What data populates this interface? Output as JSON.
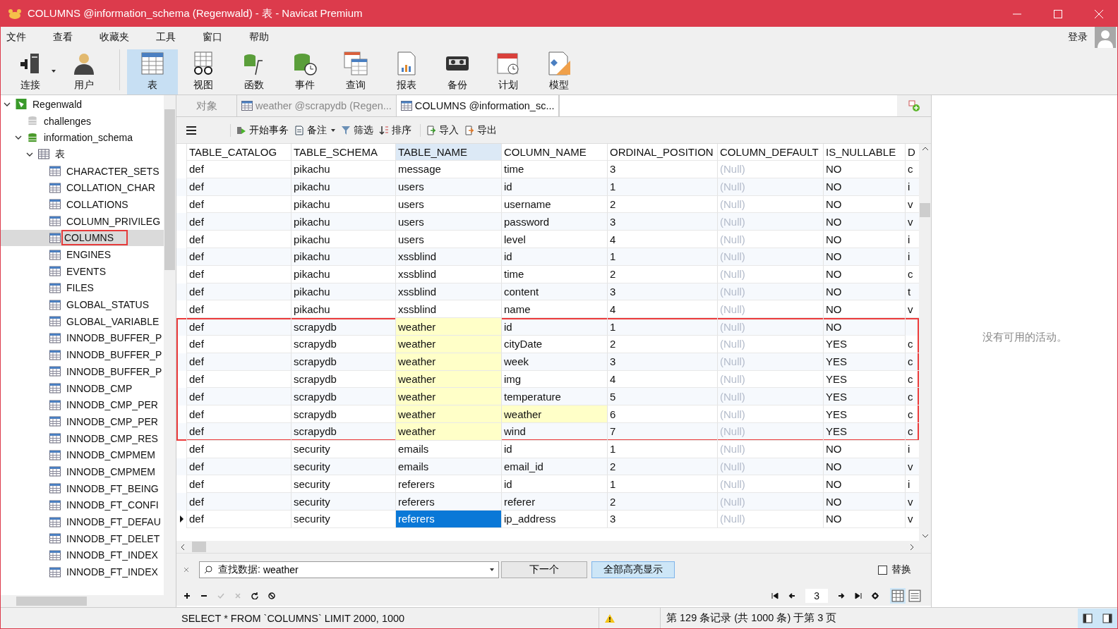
{
  "window": {
    "title": "COLUMNS @information_schema (Regenwald) - 表 - Navicat Premium"
  },
  "menu": [
    "文件",
    "查看",
    "收藏夹",
    "工具",
    "窗口",
    "帮助"
  ],
  "login": "登录",
  "toolbar": [
    {
      "kind": "connect",
      "label": "连接",
      "selected": false
    },
    {
      "kind": "user",
      "label": "用户",
      "selected": false
    },
    {
      "kind": "table",
      "label": "表",
      "selected": true
    },
    {
      "kind": "view",
      "label": "视图",
      "selected": false
    },
    {
      "kind": "function",
      "label": "函数",
      "selected": false
    },
    {
      "kind": "event",
      "label": "事件",
      "selected": false
    },
    {
      "kind": "query",
      "label": "查询",
      "selected": false
    },
    {
      "kind": "report",
      "label": "报表",
      "selected": false
    },
    {
      "kind": "backup",
      "label": "备份",
      "selected": false
    },
    {
      "kind": "schedule",
      "label": "计划",
      "selected": false
    },
    {
      "kind": "model",
      "label": "模型",
      "selected": false
    }
  ],
  "tree": [
    {
      "kind": "connection",
      "label": "Regenwald",
      "expanded": true,
      "children": [
        {
          "kind": "db-off",
          "label": "challenges"
        },
        {
          "kind": "db",
          "label": "information_schema",
          "expanded": true,
          "children": [
            {
              "kind": "folder",
              "label": "表",
              "expanded": true,
              "children": [
                {
                  "kind": "table",
                  "label": "CHARACTER_SETS",
                  "selected": false
                },
                {
                  "kind": "table",
                  "label": "COLLATION_CHAR",
                  "selected": false
                },
                {
                  "kind": "table",
                  "label": "COLLATIONS",
                  "selected": false
                },
                {
                  "kind": "table",
                  "label": "COLUMN_PRIVILEG",
                  "selected": false
                },
                {
                  "kind": "table",
                  "label": "COLUMNS",
                  "selected": true,
                  "marked": true
                },
                {
                  "kind": "table",
                  "label": "ENGINES",
                  "selected": false
                },
                {
                  "kind": "table",
                  "label": "EVENTS",
                  "selected": false
                },
                {
                  "kind": "table",
                  "label": "FILES",
                  "selected": false
                },
                {
                  "kind": "table",
                  "label": "GLOBAL_STATUS",
                  "selected": false
                },
                {
                  "kind": "table",
                  "label": "GLOBAL_VARIABLE",
                  "selected": false
                },
                {
                  "kind": "table",
                  "label": "INNODB_BUFFER_P",
                  "selected": false
                },
                {
                  "kind": "table",
                  "label": "INNODB_BUFFER_P",
                  "selected": false
                },
                {
                  "kind": "table",
                  "label": "INNODB_BUFFER_P",
                  "selected": false
                },
                {
                  "kind": "table",
                  "label": "INNODB_CMP",
                  "selected": false
                },
                {
                  "kind": "table",
                  "label": "INNODB_CMP_PER",
                  "selected": false
                },
                {
                  "kind": "table",
                  "label": "INNODB_CMP_PER",
                  "selected": false
                },
                {
                  "kind": "table",
                  "label": "INNODB_CMP_RES",
                  "selected": false
                },
                {
                  "kind": "table",
                  "label": "INNODB_CMPMEM",
                  "selected": false
                },
                {
                  "kind": "table",
                  "label": "INNODB_CMPMEM",
                  "selected": false
                },
                {
                  "kind": "table",
                  "label": "INNODB_FT_BEING",
                  "selected": false
                },
                {
                  "kind": "table",
                  "label": "INNODB_FT_CONFI",
                  "selected": false
                },
                {
                  "kind": "table",
                  "label": "INNODB_FT_DEFAU",
                  "selected": false
                },
                {
                  "kind": "table",
                  "label": "INNODB_FT_DELET",
                  "selected": false
                },
                {
                  "kind": "table",
                  "label": "INNODB_FT_INDEX",
                  "selected": false
                },
                {
                  "kind": "table",
                  "label": "INNODB_FT_INDEX",
                  "selected": false
                }
              ]
            }
          ]
        }
      ]
    }
  ],
  "tabs": [
    {
      "kind": "objects",
      "label": "对象",
      "selected": false
    },
    {
      "kind": "table",
      "label": "weather @scrapydb (Regen...",
      "selected": false
    },
    {
      "kind": "table",
      "label": "COLUMNS @information_sc...",
      "selected": true
    }
  ],
  "grid_toolbar": [
    {
      "kind": "transaction",
      "label": "开始事务"
    },
    {
      "kind": "memo",
      "label": "备注"
    },
    {
      "kind": "filter",
      "label": "筛选"
    },
    {
      "kind": "sort",
      "label": "排序"
    },
    {
      "kind": "import",
      "label": "导入"
    },
    {
      "kind": "export",
      "label": "导出"
    }
  ],
  "columns": [
    {
      "label": "TABLE_CATALOG",
      "selected": false
    },
    {
      "label": "TABLE_SCHEMA",
      "selected": false
    },
    {
      "label": "TABLE_NAME",
      "selected": true
    },
    {
      "label": "COLUMN_NAME",
      "selected": false
    },
    {
      "label": "ORDINAL_POSITION",
      "selected": false
    },
    {
      "label": "COLUMN_DEFAULT",
      "selected": false
    },
    {
      "label": "IS_NULLABLE",
      "selected": false
    },
    {
      "label": "D",
      "selected": false
    }
  ],
  "rows": [
    {
      "in_frame": false,
      "cells": [
        {
          "text": "def",
          "kind": "text"
        },
        {
          "text": "pikachu",
          "kind": "text"
        },
        {
          "text": "message",
          "kind": "text"
        },
        {
          "text": "time",
          "kind": "text"
        },
        {
          "text": "3",
          "kind": "text"
        },
        {
          "text": "(Null)",
          "kind": "null"
        },
        {
          "text": "NO",
          "kind": "text"
        },
        {
          "text": "c",
          "kind": "text"
        }
      ]
    },
    {
      "in_frame": false,
      "cells": [
        {
          "text": "def",
          "kind": "text"
        },
        {
          "text": "pikachu",
          "kind": "text"
        },
        {
          "text": "users",
          "kind": "text"
        },
        {
          "text": "id",
          "kind": "text"
        },
        {
          "text": "1",
          "kind": "text"
        },
        {
          "text": "(Null)",
          "kind": "null"
        },
        {
          "text": "NO",
          "kind": "text"
        },
        {
          "text": "i",
          "kind": "text"
        }
      ]
    },
    {
      "in_frame": false,
      "cells": [
        {
          "text": "def",
          "kind": "text"
        },
        {
          "text": "pikachu",
          "kind": "text"
        },
        {
          "text": "users",
          "kind": "text"
        },
        {
          "text": "username",
          "kind": "text"
        },
        {
          "text": "2",
          "kind": "text"
        },
        {
          "text": "(Null)",
          "kind": "null"
        },
        {
          "text": "NO",
          "kind": "text"
        },
        {
          "text": "v",
          "kind": "text"
        }
      ]
    },
    {
      "in_frame": false,
      "cells": [
        {
          "text": "def",
          "kind": "text"
        },
        {
          "text": "pikachu",
          "kind": "text"
        },
        {
          "text": "users",
          "kind": "text"
        },
        {
          "text": "password",
          "kind": "text"
        },
        {
          "text": "3",
          "kind": "text"
        },
        {
          "text": "(Null)",
          "kind": "null"
        },
        {
          "text": "NO",
          "kind": "text"
        },
        {
          "text": "v",
          "kind": "text"
        }
      ]
    },
    {
      "in_frame": false,
      "cells": [
        {
          "text": "def",
          "kind": "text"
        },
        {
          "text": "pikachu",
          "kind": "text"
        },
        {
          "text": "users",
          "kind": "text"
        },
        {
          "text": "level",
          "kind": "text"
        },
        {
          "text": "4",
          "kind": "text"
        },
        {
          "text": "(Null)",
          "kind": "null"
        },
        {
          "text": "NO",
          "kind": "text"
        },
        {
          "text": "i",
          "kind": "text"
        }
      ]
    },
    {
      "in_frame": false,
      "cells": [
        {
          "text": "def",
          "kind": "text"
        },
        {
          "text": "pikachu",
          "kind": "text"
        },
        {
          "text": "xssblind",
          "kind": "text"
        },
        {
          "text": "id",
          "kind": "text"
        },
        {
          "text": "1",
          "kind": "text"
        },
        {
          "text": "(Null)",
          "kind": "null"
        },
        {
          "text": "NO",
          "kind": "text"
        },
        {
          "text": "i",
          "kind": "text"
        }
      ]
    },
    {
      "in_frame": false,
      "cells": [
        {
          "text": "def",
          "kind": "text"
        },
        {
          "text": "pikachu",
          "kind": "text"
        },
        {
          "text": "xssblind",
          "kind": "text"
        },
        {
          "text": "time",
          "kind": "text"
        },
        {
          "text": "2",
          "kind": "text"
        },
        {
          "text": "(Null)",
          "kind": "null"
        },
        {
          "text": "NO",
          "kind": "text"
        },
        {
          "text": "c",
          "kind": "text"
        }
      ]
    },
    {
      "in_frame": false,
      "cells": [
        {
          "text": "def",
          "kind": "text"
        },
        {
          "text": "pikachu",
          "kind": "text"
        },
        {
          "text": "xssblind",
          "kind": "text"
        },
        {
          "text": "content",
          "kind": "text"
        },
        {
          "text": "3",
          "kind": "text"
        },
        {
          "text": "(Null)",
          "kind": "null"
        },
        {
          "text": "NO",
          "kind": "text"
        },
        {
          "text": "t",
          "kind": "text"
        }
      ]
    },
    {
      "in_frame": false,
      "cells": [
        {
          "text": "def",
          "kind": "text"
        },
        {
          "text": "pikachu",
          "kind": "text"
        },
        {
          "text": "xssblind",
          "kind": "text"
        },
        {
          "text": "name",
          "kind": "text"
        },
        {
          "text": "4",
          "kind": "text"
        },
        {
          "text": "(Null)",
          "kind": "null"
        },
        {
          "text": "NO",
          "kind": "text"
        },
        {
          "text": "v",
          "kind": "text"
        }
      ]
    },
    {
      "in_frame": true,
      "cells": [
        {
          "text": "def",
          "kind": "text"
        },
        {
          "text": "scrapydb",
          "kind": "text"
        },
        {
          "text": "weather",
          "kind": "match"
        },
        {
          "text": "id",
          "kind": "text"
        },
        {
          "text": "1",
          "kind": "text"
        },
        {
          "text": "(Null)",
          "kind": "null"
        },
        {
          "text": "NO",
          "kind": "text"
        }
      ]
    },
    {
      "in_frame": true,
      "cells": [
        {
          "text": "def",
          "kind": "text"
        },
        {
          "text": "scrapydb",
          "kind": "text"
        },
        {
          "text": "weather",
          "kind": "match"
        },
        {
          "text": "cityDate",
          "kind": "text"
        },
        {
          "text": "2",
          "kind": "text"
        },
        {
          "text": "(Null)",
          "kind": "null"
        },
        {
          "text": "YES",
          "kind": "text"
        },
        {
          "text": "c",
          "kind": "text"
        }
      ]
    },
    {
      "in_frame": true,
      "cells": [
        {
          "text": "def",
          "kind": "text"
        },
        {
          "text": "scrapydb",
          "kind": "text"
        },
        {
          "text": "weather",
          "kind": "match"
        },
        {
          "text": "week",
          "kind": "text"
        },
        {
          "text": "3",
          "kind": "text"
        },
        {
          "text": "(Null)",
          "kind": "null"
        },
        {
          "text": "YES",
          "kind": "text"
        },
        {
          "text": "c",
          "kind": "text"
        }
      ]
    },
    {
      "in_frame": true,
      "cells": [
        {
          "text": "def",
          "kind": "text"
        },
        {
          "text": "scrapydb",
          "kind": "text"
        },
        {
          "text": "weather",
          "kind": "match"
        },
        {
          "text": "img",
          "kind": "text"
        },
        {
          "text": "4",
          "kind": "text"
        },
        {
          "text": "(Null)",
          "kind": "null"
        },
        {
          "text": "YES",
          "kind": "text"
        },
        {
          "text": "c",
          "kind": "text"
        }
      ]
    },
    {
      "in_frame": true,
      "cells": [
        {
          "text": "def",
          "kind": "text"
        },
        {
          "text": "scrapydb",
          "kind": "text"
        },
        {
          "text": "weather",
          "kind": "match"
        },
        {
          "text": "temperature",
          "kind": "text"
        },
        {
          "text": "5",
          "kind": "text"
        },
        {
          "text": "(Null)",
          "kind": "null"
        },
        {
          "text": "YES",
          "kind": "text"
        },
        {
          "text": "c",
          "kind": "text"
        }
      ]
    },
    {
      "in_frame": true,
      "cells": [
        {
          "text": "def",
          "kind": "text"
        },
        {
          "text": "scrapydb",
          "kind": "text"
        },
        {
          "text": "weather",
          "kind": "match"
        },
        {
          "text": "weather",
          "kind": "match"
        },
        {
          "text": "6",
          "kind": "text"
        },
        {
          "text": "(Null)",
          "kind": "null"
        },
        {
          "text": "YES",
          "kind": "text"
        },
        {
          "text": "c",
          "kind": "text"
        }
      ]
    },
    {
      "in_frame": true,
      "cells": [
        {
          "text": "def",
          "kind": "text"
        },
        {
          "text": "scrapydb",
          "kind": "text"
        },
        {
          "text": "weather",
          "kind": "match"
        },
        {
          "text": "wind",
          "kind": "text"
        },
        {
          "text": "7",
          "kind": "text"
        },
        {
          "text": "(Null)",
          "kind": "null"
        },
        {
          "text": "YES",
          "kind": "text"
        },
        {
          "text": "c",
          "kind": "text"
        }
      ]
    },
    {
      "in_frame": false,
      "cells": [
        {
          "text": "def",
          "kind": "text"
        },
        {
          "text": "security",
          "kind": "text"
        },
        {
          "text": "emails",
          "kind": "text"
        },
        {
          "text": "id",
          "kind": "text"
        },
        {
          "text": "1",
          "kind": "text"
        },
        {
          "text": "(Null)",
          "kind": "null"
        },
        {
          "text": "NO",
          "kind": "text"
        },
        {
          "text": "i",
          "kind": "text"
        }
      ]
    },
    {
      "in_frame": false,
      "cells": [
        {
          "text": "def",
          "kind": "text"
        },
        {
          "text": "security",
          "kind": "text"
        },
        {
          "text": "emails",
          "kind": "text"
        },
        {
          "text": "email_id",
          "kind": "text"
        },
        {
          "text": "2",
          "kind": "text"
        },
        {
          "text": "(Null)",
          "kind": "null"
        },
        {
          "text": "NO",
          "kind": "text"
        },
        {
          "text": "v",
          "kind": "text"
        }
      ]
    },
    {
      "in_frame": false,
      "cells": [
        {
          "text": "def",
          "kind": "text"
        },
        {
          "text": "security",
          "kind": "text"
        },
        {
          "text": "referers",
          "kind": "text"
        },
        {
          "text": "id",
          "kind": "text"
        },
        {
          "text": "1",
          "kind": "text"
        },
        {
          "text": "(Null)",
          "kind": "null"
        },
        {
          "text": "NO",
          "kind": "text"
        },
        {
          "text": "i",
          "kind": "text"
        }
      ]
    },
    {
      "in_frame": false,
      "cells": [
        {
          "text": "def",
          "kind": "text"
        },
        {
          "text": "security",
          "kind": "text"
        },
        {
          "text": "referers",
          "kind": "text"
        },
        {
          "text": "referer",
          "kind": "text"
        },
        {
          "text": "2",
          "kind": "text"
        },
        {
          "text": "(Null)",
          "kind": "null"
        },
        {
          "text": "NO",
          "kind": "text"
        },
        {
          "text": "v",
          "kind": "text"
        }
      ]
    },
    {
      "in_frame": false,
      "current": true,
      "cells": [
        {
          "text": "def",
          "kind": "text"
        },
        {
          "text": "security",
          "kind": "text"
        },
        {
          "text": "referers",
          "kind": "current"
        },
        {
          "text": "ip_address",
          "kind": "text"
        },
        {
          "text": "3",
          "kind": "text"
        },
        {
          "text": "(Null)",
          "kind": "null"
        },
        {
          "text": "NO",
          "kind": "text"
        },
        {
          "text": "v",
          "kind": "text"
        }
      ]
    }
  ],
  "find": {
    "label": "查找数据:",
    "value": "weather",
    "next": "下一个",
    "highlight_all": "全部高亮显示",
    "highlight_on": true,
    "replace": "替换",
    "replace_checked": false
  },
  "pager": {
    "page": "3"
  },
  "status": {
    "sql": "SELECT * FROM `COLUMNS` LIMIT 2000, 1000",
    "records": "第 129 条记录 (共 1000 条) 于第 3 页",
    "warning": true
  },
  "activity": "没有可用的活动。"
}
